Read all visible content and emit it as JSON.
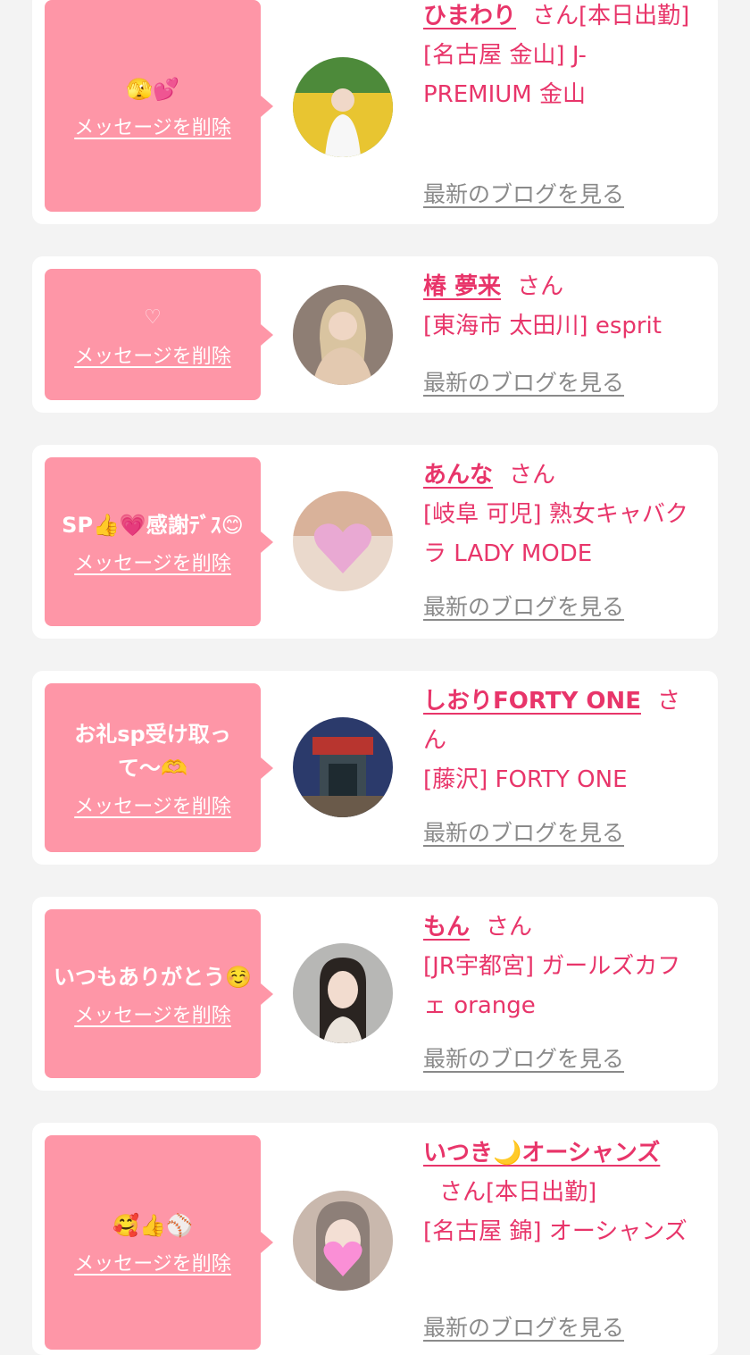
{
  "labels": {
    "delete": "メッセージを削除",
    "blog": "最新のブログを見る",
    "san": "さん"
  },
  "entries": [
    {
      "message": "🫣💕",
      "name": "ひまわり",
      "status": "[本日出勤]",
      "shop": "[名古屋 金山] J-PREMIUM 金山",
      "avatar_colors": [
        "#4d8a3a",
        "#e8c531"
      ]
    },
    {
      "message": "♡",
      "name": "椿 夢来",
      "status": "",
      "shop": "[東海市 太田川] esprit",
      "avatar_colors": [
        "#8e7e74",
        "#d9c4a0"
      ]
    },
    {
      "message": "SP👍💗感謝ﾃﾞｽ😊",
      "name": "あんな",
      "status": "",
      "shop": "[岐阜 可児] 熟女キャバクラ LADY MODE",
      "avatar_colors": [
        "#d9b29a",
        "#e9a9d3"
      ]
    },
    {
      "message": "お礼sp受け取って〜🫶",
      "name": "しおりFORTY ONE",
      "status": "",
      "shop": "[藤沢] FORTY ONE",
      "avatar_colors": [
        "#2b3a6b",
        "#b8352f"
      ]
    },
    {
      "message": "いつもありがとう☺️",
      "name": "もん",
      "status": "",
      "shop": "[JR宇都宮] ガールズカフェ orange",
      "avatar_colors": [
        "#b7b7b5",
        "#2a2421"
      ]
    },
    {
      "message": "🥰👍⚾️",
      "name": "いつき🌙オーシャンズ",
      "status": "[本日出勤]",
      "shop": "[名古屋 錦] オーシャンズ",
      "avatar_colors": [
        "#c9b8ad",
        "#fa8fd6"
      ]
    }
  ]
}
